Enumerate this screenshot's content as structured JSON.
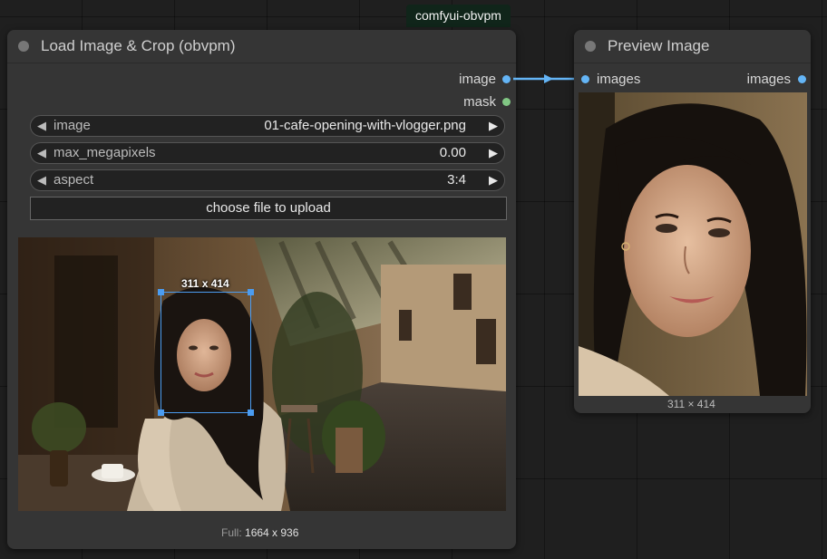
{
  "group_badge": "comfyui-obvpm",
  "load_node": {
    "title": "Load Image & Crop (obvpm)",
    "outputs": [
      {
        "label": "image",
        "color": "#64b5f6"
      },
      {
        "label": "mask",
        "color": "#81c784"
      }
    ],
    "widgets": [
      {
        "label": "image",
        "value": "01-cafe-opening-with-vlogger.png"
      },
      {
        "label": "max_megapixels",
        "value": "0.00"
      },
      {
        "label": "aspect",
        "value": "3:4"
      }
    ],
    "upload_label": "choose file to upload",
    "crop_label": "311 x 414",
    "full_prefix": "Full:",
    "full_size": "1664 x 936"
  },
  "preview_node": {
    "title": "Preview Image",
    "input_label": "images",
    "output_label": "images",
    "size_caption": "311 × 414"
  },
  "colors": {
    "link": "#64b5f6",
    "crop": "#4b9cf0",
    "node_bg": "#353535",
    "canvas_bg": "#1f1f1f"
  }
}
